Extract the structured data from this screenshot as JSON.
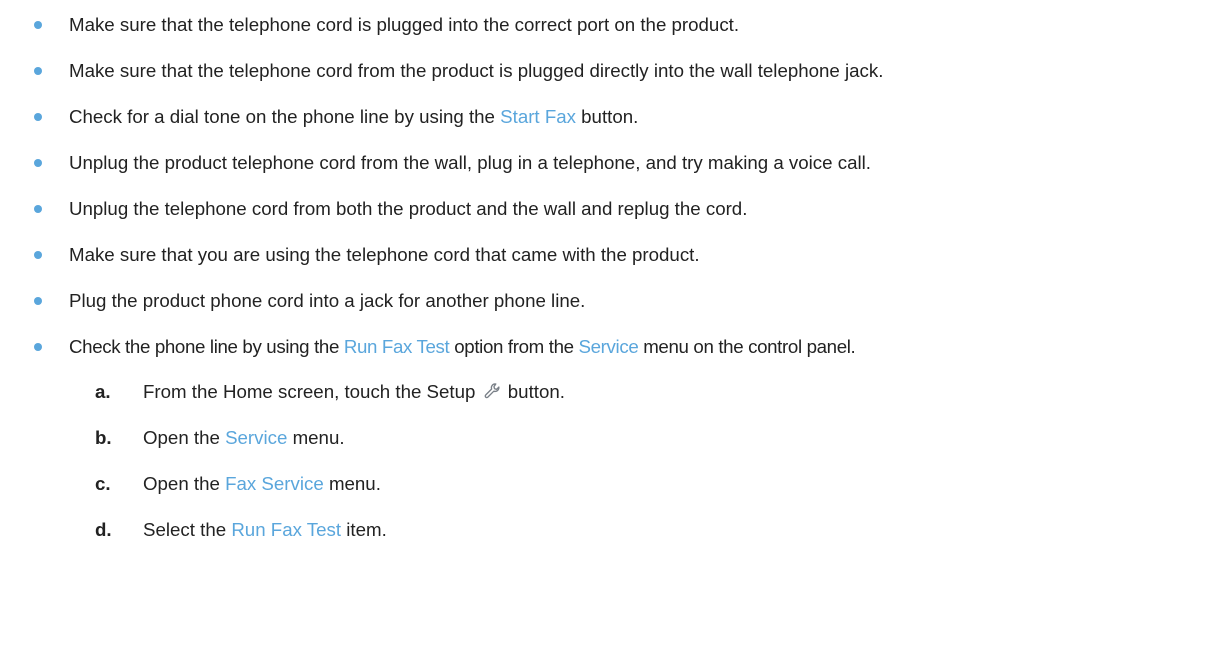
{
  "bullets": [
    {
      "text": "Make sure that the telephone cord is plugged into the correct port on the product."
    },
    {
      "text": "Make sure that the telephone cord from the product is plugged directly into the wall telephone jack."
    },
    {
      "pre": "Check for a dial tone on the phone line by using the ",
      "ui": "Start Fax",
      "post": " button."
    },
    {
      "text": "Unplug the product telephone cord from the wall, plug in a telephone, and try making a voice call."
    },
    {
      "text": "Unplug the telephone cord from both the product and the wall and replug the cord."
    },
    {
      "text": "Make sure that you are using the telephone cord that came with the product."
    },
    {
      "text": "Plug the product phone cord into a jack for another phone line."
    },
    {
      "pre": "Check the phone line by using the ",
      "ui1": "Run Fax Test",
      "mid": " option from the ",
      "ui2": "Service",
      "post": " menu on the control panel."
    }
  ],
  "steps": [
    {
      "letter": "a.",
      "pre": "From the Home screen, touch the Setup ",
      "icon": "wrench-icon",
      "post": " button."
    },
    {
      "letter": "b.",
      "pre": "Open the ",
      "ui": "Service",
      "post": " menu."
    },
    {
      "letter": "c.",
      "pre": "Open the ",
      "ui": "Fax Service",
      "post": " menu."
    },
    {
      "letter": "d.",
      "pre": "Select the ",
      "ui": "Run Fax Test",
      "post": " item."
    }
  ],
  "colors": {
    "accent": "#5aa6dc",
    "text": "#222222"
  }
}
